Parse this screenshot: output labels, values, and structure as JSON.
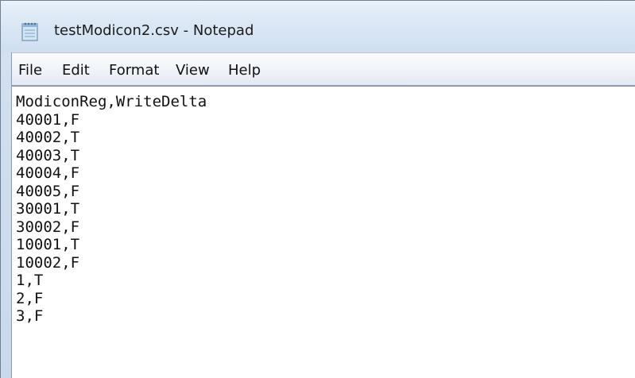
{
  "window": {
    "title": "testModicon2.csv - Notepad",
    "icon": "notepad-icon"
  },
  "menu": {
    "items": [
      "File",
      "Edit",
      "Format",
      "View",
      "Help"
    ]
  },
  "editor": {
    "text": "ModiconReg,WriteDelta\n40001,F\n40002,T\n40003,T\n40004,F\n40005,F\n30001,T\n30002,F\n10001,T\n10002,F\n1,T\n2,F\n3,F"
  },
  "colors": {
    "titlebar": "#dbe7f5",
    "menubar": "#eef2f8",
    "text": "#111111"
  }
}
